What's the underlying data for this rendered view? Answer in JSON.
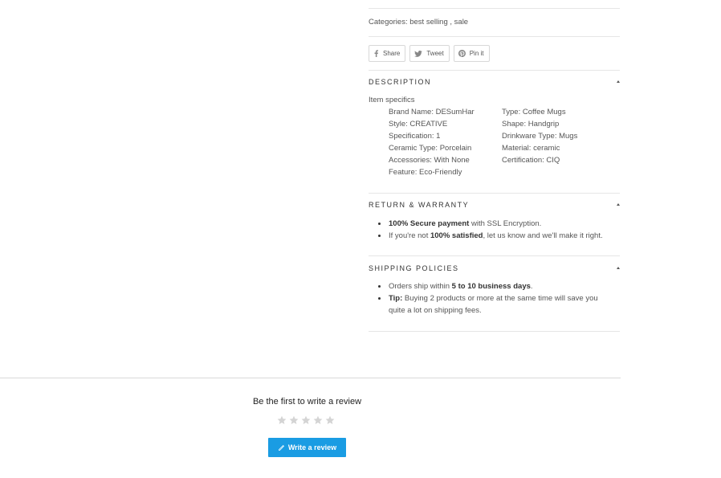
{
  "categories": {
    "label": "Categories: best selling , sale"
  },
  "share": {
    "buttons": [
      {
        "label": "Share",
        "icon": "facebook-icon"
      },
      {
        "label": "Tweet",
        "icon": "twitter-icon"
      },
      {
        "label": "Pin it",
        "icon": "pinterest-icon"
      }
    ]
  },
  "description": {
    "title": "DESCRIPTION",
    "item_specifics_label": "Item specifics",
    "specs_left": [
      "Brand Name: DESumHar",
      "Style: CREATIVE",
      "Specification: 1",
      "Ceramic Type: Porcelain",
      "Accessories: With None",
      "Feature: Eco-Friendly"
    ],
    "specs_right": [
      "Type: Coffee Mugs",
      "Shape: Handgrip",
      "Drinkware Type: Mugs",
      "Material: ceramic",
      "Certification: CIQ"
    ]
  },
  "return_warranty": {
    "title": "RETURN & WARRANTY",
    "items": [
      {
        "bold": "100% Secure payment",
        "text": " with SSL Encryption."
      },
      {
        "pre": "If you're not ",
        "bold": "100% satisfied",
        "text": ", let us know and we'll make it right."
      }
    ]
  },
  "shipping": {
    "title": "SHIPPING POLICIES",
    "items": [
      {
        "pre": "Orders ship within ",
        "bold": "5 to 10 business days",
        "text": "."
      },
      {
        "bold": "Tip:",
        "text": " Buying 2 products or more at the same time will save you quite a lot on shipping fees."
      }
    ]
  },
  "reviews": {
    "heading": "Be the first to write a review",
    "rating": 0,
    "max_rating": 5,
    "write_button_label": "Write a review"
  },
  "colors": {
    "accent": "#1a9ce3",
    "star_empty": "#d4d4d4",
    "divider": "#e6e6e6"
  }
}
